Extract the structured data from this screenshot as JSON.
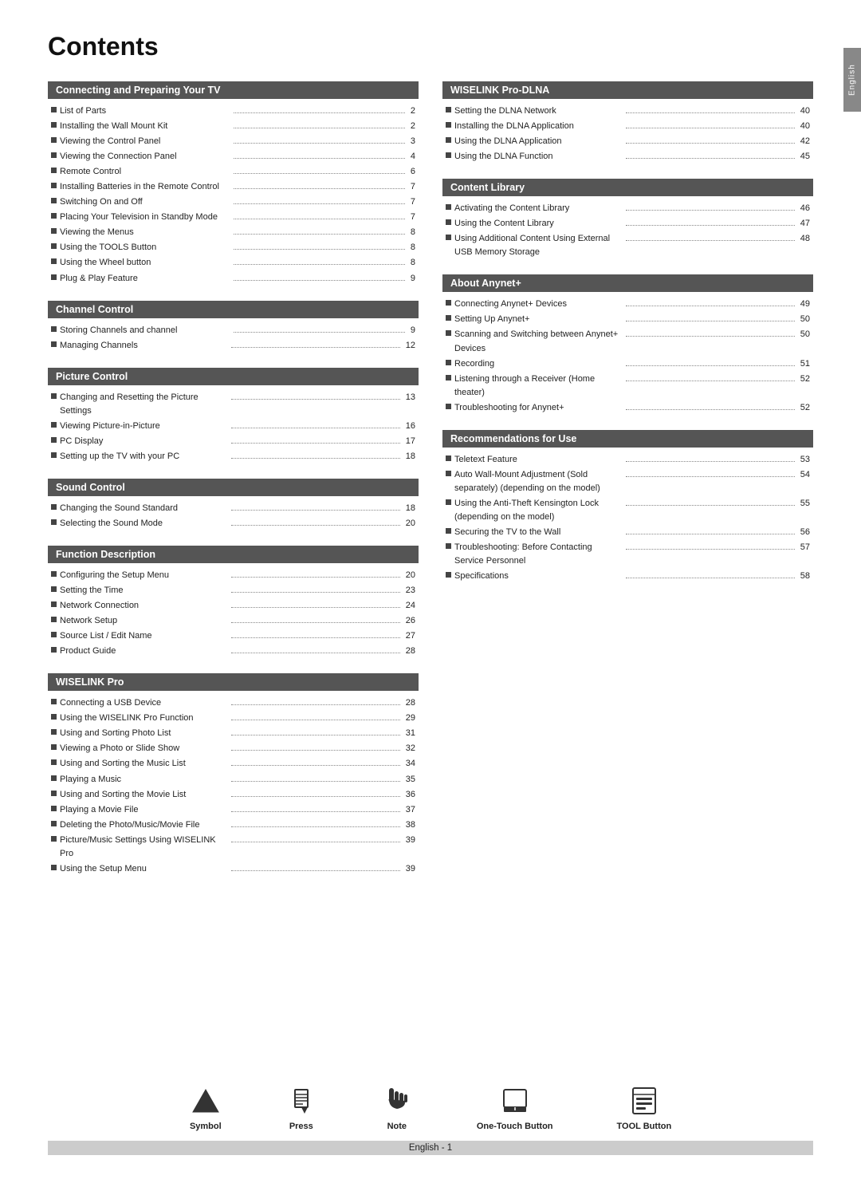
{
  "page": {
    "title": "Contents",
    "side_tab": "English",
    "footer": {
      "page_label": "English - 1"
    }
  },
  "footer_icons": [
    {
      "name": "symbol-icon",
      "label": "Symbol",
      "icon_type": "triangle-up"
    },
    {
      "name": "press-icon",
      "label": "Press",
      "icon_type": "pencil"
    },
    {
      "name": "note-icon",
      "label": "Note",
      "icon_type": "hand"
    },
    {
      "name": "one-touch-icon",
      "label": "One-Touch Button",
      "icon_type": "one-touch"
    },
    {
      "name": "tool-button-icon",
      "label": "TOOL Button",
      "icon_type": "tool-button"
    }
  ],
  "left_sections": [
    {
      "id": "connecting",
      "header": "Connecting and Preparing Your TV",
      "items": [
        {
          "label": "List of Parts",
          "page": "2"
        },
        {
          "label": "Installing the Wall Mount Kit",
          "page": "2"
        },
        {
          "label": "Viewing the Control Panel",
          "page": "3"
        },
        {
          "label": "Viewing the Connection Panel",
          "page": "4"
        },
        {
          "label": "Remote Control",
          "page": "6"
        },
        {
          "label": "Installing Batteries in the Remote Control",
          "page": "7"
        },
        {
          "label": "Switching On and Off",
          "page": "7"
        },
        {
          "label": "Placing Your Television in Standby Mode",
          "page": "7"
        },
        {
          "label": "Viewing the Menus",
          "page": "8"
        },
        {
          "label": "Using the TOOLS Button",
          "page": "8"
        },
        {
          "label": "Using the Wheel button",
          "page": "8"
        },
        {
          "label": "Plug & Play Feature",
          "page": "9"
        }
      ]
    },
    {
      "id": "channel",
      "header": "Channel Control",
      "items": [
        {
          "label": "Storing Channels and channel",
          "page": "9"
        },
        {
          "label": "Managing Channels",
          "page": "12"
        }
      ]
    },
    {
      "id": "picture",
      "header": "Picture Control",
      "items": [
        {
          "label": "Changing and Resetting the Picture Settings",
          "page": "13"
        },
        {
          "label": "Viewing Picture-in-Picture",
          "page": "16"
        },
        {
          "label": "PC Display",
          "page": "17"
        },
        {
          "label": "Setting up the TV with your PC",
          "page": "18"
        }
      ]
    },
    {
      "id": "sound",
      "header": "Sound Control",
      "items": [
        {
          "label": "Changing the Sound Standard",
          "page": "18"
        },
        {
          "label": "Selecting the Sound Mode",
          "page": "20"
        }
      ]
    },
    {
      "id": "function",
      "header": "Function Description",
      "items": [
        {
          "label": "Configuring the Setup Menu",
          "page": "20"
        },
        {
          "label": "Setting the Time",
          "page": "23"
        },
        {
          "label": "Network Connection",
          "page": "24"
        },
        {
          "label": "Network Setup",
          "page": "26"
        },
        {
          "label": "Source List / Edit Name",
          "page": "27"
        },
        {
          "label": "Product Guide",
          "page": "28"
        }
      ]
    },
    {
      "id": "wiselink",
      "header": "WISELINK Pro",
      "items": [
        {
          "label": "Connecting a USB Device",
          "page": "28"
        },
        {
          "label": "Using the WISELINK Pro Function",
          "page": "29"
        },
        {
          "label": "Using and Sorting Photo List",
          "page": "31"
        },
        {
          "label": "Viewing a Photo or Slide Show",
          "page": "32"
        },
        {
          "label": "Using and Sorting the Music List",
          "page": "34"
        },
        {
          "label": "Playing a Music",
          "page": "35"
        },
        {
          "label": "Using and Sorting the Movie List",
          "page": "36"
        },
        {
          "label": "Playing a Movie File",
          "page": "37"
        },
        {
          "label": "Deleting the Photo/Music/Movie File",
          "page": "38"
        },
        {
          "label": "Picture/Music Settings Using WISELINK Pro",
          "page": "39"
        },
        {
          "label": "Using the Setup Menu",
          "page": "39"
        }
      ]
    }
  ],
  "right_sections": [
    {
      "id": "wiselink-dlna",
      "header": "WISELINK Pro-DLNA",
      "items": [
        {
          "label": "Setting the DLNA Network",
          "page": "40"
        },
        {
          "label": "Installing the DLNA Application",
          "page": "40"
        },
        {
          "label": "Using the DLNA Application",
          "page": "42"
        },
        {
          "label": "Using the DLNA Function",
          "page": "45"
        }
      ]
    },
    {
      "id": "content-library",
      "header": "Content Library",
      "items": [
        {
          "label": "Activating the Content Library",
          "page": "46"
        },
        {
          "label": "Using the Content Library",
          "page": "47"
        },
        {
          "label": "Using Additional Content Using External USB Memory Storage",
          "page": "48"
        }
      ]
    },
    {
      "id": "anynet",
      "header": "About Anynet+",
      "items": [
        {
          "label": "Connecting Anynet+ Devices",
          "page": "49"
        },
        {
          "label": "Setting Up Anynet+",
          "page": "50"
        },
        {
          "label": "Scanning and Switching between Anynet+ Devices",
          "page": "50"
        },
        {
          "label": "Recording",
          "page": "51"
        },
        {
          "label": "Listening through a Receiver (Home theater)",
          "page": "52"
        },
        {
          "label": "Troubleshooting for Anynet+",
          "page": "52"
        }
      ]
    },
    {
      "id": "recommendations",
      "header": "Recommendations for Use",
      "items": [
        {
          "label": "Teletext Feature",
          "page": "53"
        },
        {
          "label": "Auto Wall-Mount Adjustment (Sold separately) (depending on the model)",
          "page": "54"
        },
        {
          "label": "Using the Anti-Theft Kensington Lock (depending on the model)",
          "page": "55"
        },
        {
          "label": "Securing the TV to the Wall",
          "page": "56"
        },
        {
          "label": "Troubleshooting: Before Contacting Service Personnel",
          "page": "57"
        },
        {
          "label": "Specifications",
          "page": "58"
        }
      ]
    }
  ]
}
